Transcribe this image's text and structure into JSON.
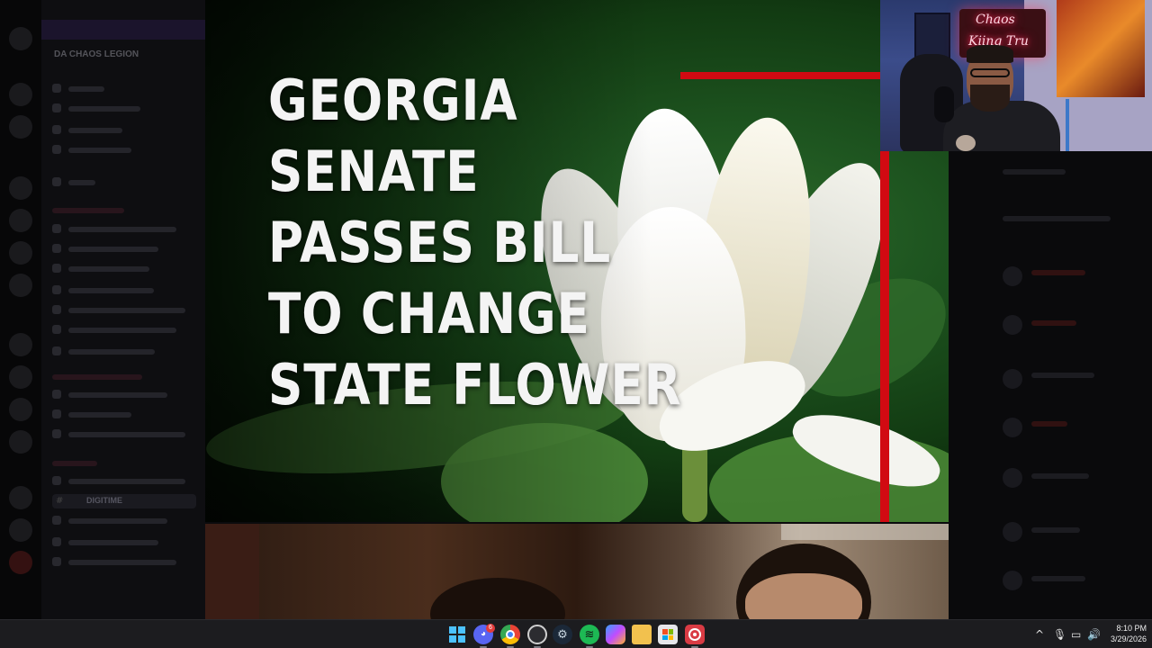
{
  "background_app": {
    "server_name": "DA CHAOS LEGION",
    "active_channel": "DIGITIME"
  },
  "video": {
    "headline_lines": [
      "GEORGIA",
      "SENATE",
      "PASSES BILL",
      "TO CHANGE",
      "STATE FLOWER"
    ]
  },
  "webcam": {
    "neon_sign_line1": "Chaos",
    "neon_sign_line2": "Kiing Tru"
  },
  "taskbar": {
    "discord_badge": "6",
    "apps": [
      "start-icon",
      "discord-icon",
      "chrome-icon",
      "obs-icon",
      "steam-icon",
      "spotify-icon",
      "copilot-icon",
      "file-explorer-icon",
      "microsoft-store-icon",
      "recorder-icon"
    ],
    "tray": {
      "chevron": "^",
      "mic": "🎙",
      "network": "▭",
      "volume": "🔊"
    },
    "clock_time": "8:10 PM",
    "clock_date": "3/29/2026"
  },
  "colors": {
    "accent_red": "#d10a12",
    "taskbar_bg": "#1c1c1f",
    "discord_blurple": "#5865f2",
    "spotify_green": "#1db954"
  }
}
